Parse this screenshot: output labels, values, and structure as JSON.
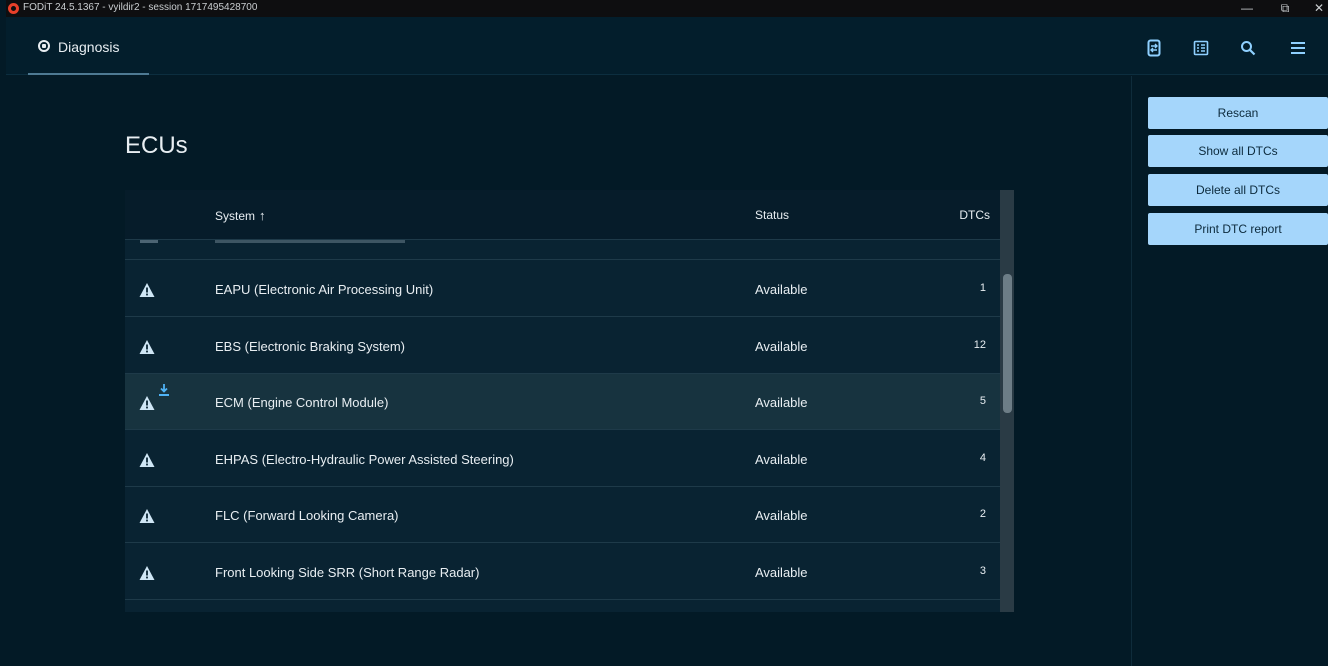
{
  "window": {
    "title": "FODiT 24.5.1367 - vyildir2 - session 1717495428700",
    "minimize": "—",
    "restore": "⧉",
    "close": "✕"
  },
  "header": {
    "tab_label": "Diagnosis",
    "icons": [
      "device-sync-icon",
      "list-view-icon",
      "search-icon",
      "menu-icon"
    ]
  },
  "page": {
    "title": "ECUs"
  },
  "table": {
    "columns": {
      "system": "System",
      "sort_arrow": "↑",
      "status": "Status",
      "dtcs": "DTCs"
    },
    "rows": [
      {
        "system": "EAPU (Electronic Air Processing Unit)",
        "status": "Available",
        "dtcs": "1",
        "highlighted": false,
        "download": false
      },
      {
        "system": "EBS (Electronic Braking System)",
        "status": "Available",
        "dtcs": "12",
        "highlighted": false,
        "download": false
      },
      {
        "system": "ECM (Engine Control Module)",
        "status": "Available",
        "dtcs": "5",
        "highlighted": true,
        "download": true
      },
      {
        "system": "EHPAS (Electro-Hydraulic Power Assisted Steering)",
        "status": "Available",
        "dtcs": "4",
        "highlighted": false,
        "download": false
      },
      {
        "system": "FLC (Forward Looking Camera)",
        "status": "Available",
        "dtcs": "2",
        "highlighted": false,
        "download": false
      },
      {
        "system": "Front Looking Side SRR (Short Range Radar)",
        "status": "Available",
        "dtcs": "3",
        "highlighted": false,
        "download": false
      }
    ]
  },
  "side": {
    "rescan": "Rescan",
    "show_all": "Show all DTCs",
    "delete_all": "Delete all DTCs",
    "print_report": "Print DTC report"
  },
  "colors": {
    "background": "#031a26",
    "table_bg": "#092332",
    "button_bg": "#a5d6fb",
    "accent_icon": "#8fd0ff"
  }
}
